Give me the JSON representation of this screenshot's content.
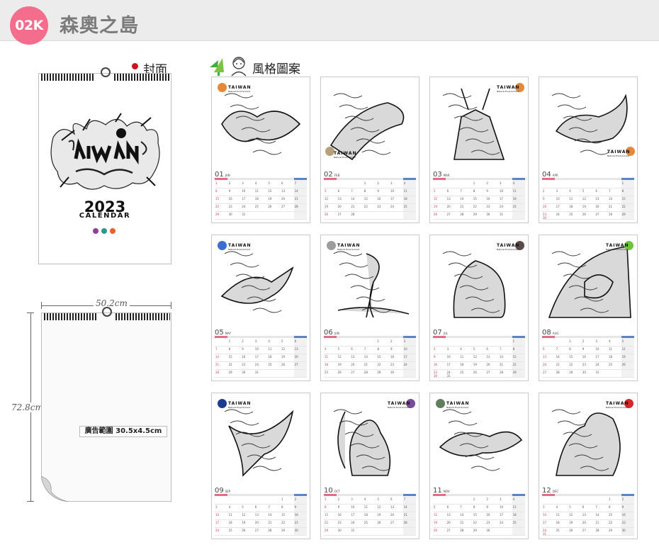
{
  "header": {
    "badge": "02K",
    "brand": "森奧之島"
  },
  "cover_section": {
    "label": "封面",
    "cover": {
      "art_title": "TAIWAN",
      "year": "2023",
      "subtitle": "CALENDAR",
      "dot_colors": [
        "#8e3f9c",
        "#2a9a8e",
        "#e5632a"
      ]
    }
  },
  "size_diagram": {
    "width_label": "50.2cm",
    "height_label": "72.8cm",
    "ad_area_label": "廣告範圍 30.5x4.5cm"
  },
  "styles_section": {
    "label": "風格圖案",
    "months": [
      {
        "num": "01",
        "abbr": "JAN",
        "brand": "TAIWAN",
        "sub": "Natural Environment",
        "seal_color": "#e4893c",
        "start": 0,
        "days": 31,
        "logo_pos": "top-left"
      },
      {
        "num": "02",
        "abbr": "FEB",
        "brand": "TAIWAN",
        "sub": "Natural Environment",
        "seal_color": "#b7a07a",
        "start": 3,
        "days": 28,
        "logo_pos": "bottom-left"
      },
      {
        "num": "03",
        "abbr": "MAR",
        "brand": "TAIWAN",
        "sub": "Natural Environment",
        "seal_color": "#e4893c",
        "start": 3,
        "days": 31,
        "logo_pos": "top-right"
      },
      {
        "num": "04",
        "abbr": "APR",
        "brand": "TAIWAN",
        "sub": "Natural Environment",
        "seal_color": "#e4893c",
        "start": 6,
        "days": 30,
        "logo_pos": "bottom-right"
      },
      {
        "num": "05",
        "abbr": "MAY",
        "brand": "TAIWAN",
        "sub": "Natural Environment",
        "seal_color": "#3a6fd0",
        "start": 1,
        "days": 31,
        "logo_pos": "top-left"
      },
      {
        "num": "06",
        "abbr": "JUN",
        "brand": "TAIWAN",
        "sub": "Natural Environment",
        "seal_color": "#9d9d9d",
        "start": 4,
        "days": 30,
        "logo_pos": "top-left"
      },
      {
        "num": "07",
        "abbr": "JUL",
        "brand": "TAIWAN",
        "sub": "Natural Environment",
        "seal_color": "#5a4a4a",
        "start": 6,
        "days": 31,
        "logo_pos": "top-right"
      },
      {
        "num": "08",
        "abbr": "AUG",
        "brand": "TAIWAN",
        "sub": "Natural Environment",
        "seal_color": "#6fc23a",
        "start": 2,
        "days": 31,
        "logo_pos": "top-right"
      },
      {
        "num": "09",
        "abbr": "SEP",
        "brand": "TAIWAN",
        "sub": "Natural Environment",
        "seal_color": "#1b3d8f",
        "start": 5,
        "days": 30,
        "logo_pos": "top-left"
      },
      {
        "num": "10",
        "abbr": "OCT",
        "brand": "TAIWAN",
        "sub": "Natural Environment",
        "seal_color": "#7a4a9c",
        "start": 0,
        "days": 31,
        "logo_pos": "top-right"
      },
      {
        "num": "11",
        "abbr": "NOV",
        "brand": "TAIWAN",
        "sub": "Natural Environment",
        "seal_color": "#5e7e5e",
        "start": 3,
        "days": 30,
        "logo_pos": "top-left"
      },
      {
        "num": "12",
        "abbr": "DEC",
        "brand": "TAIWAN",
        "sub": "Natural Environment",
        "seal_color": "#d62828",
        "start": 5,
        "days": 31,
        "logo_pos": "top-right"
      }
    ]
  },
  "colors": {
    "badge": "#f46d8c",
    "sunday": "#e46b86",
    "saturday": "#5b84c4",
    "header_bar": "#ececec"
  }
}
